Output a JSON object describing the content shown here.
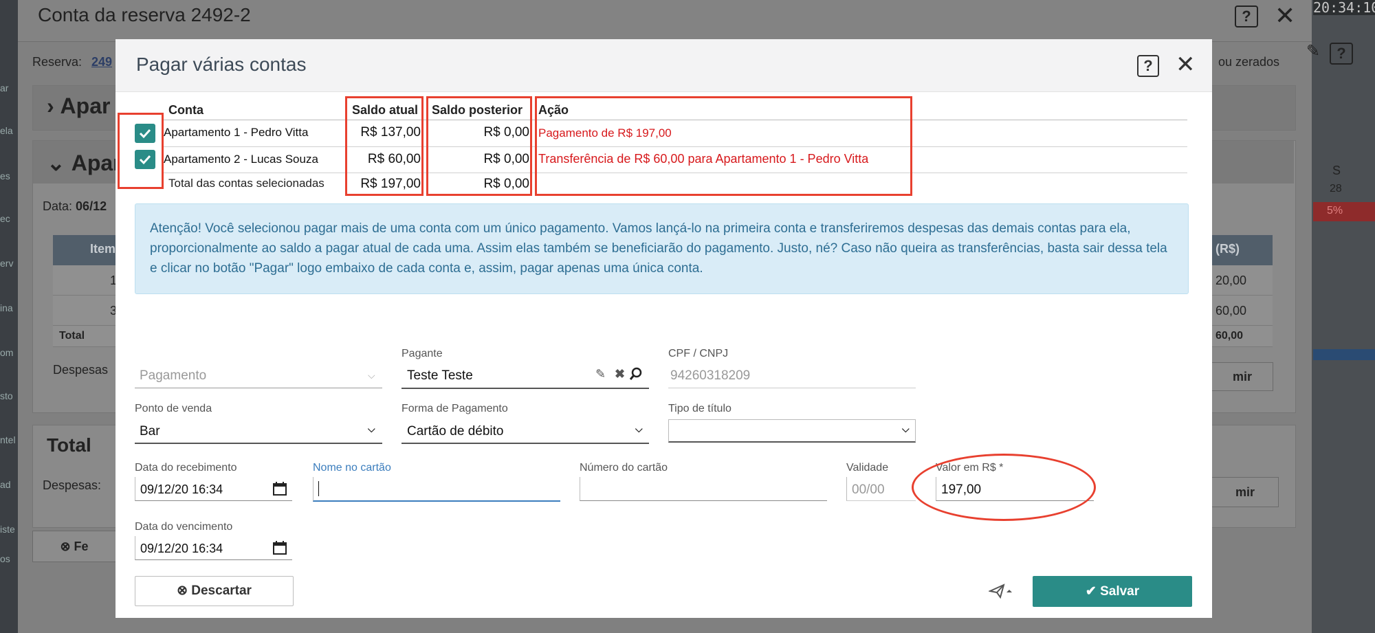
{
  "background": {
    "clock": "20:34:10",
    "outer_title": "Conta da reserva 2492-2",
    "reserva_label": "Reserva:",
    "reserva_value": "249",
    "zerados_text": "ou zerados",
    "panel1_title": "Apar",
    "panel2_title": "Apar",
    "data_label": "Data:",
    "data_value": "06/12",
    "item_header": "Item",
    "rs_header": "(R$)",
    "row1_no": "1",
    "row2_no": "3",
    "total_row": "Total",
    "row1_value": "20,00",
    "row2_value": "60,00",
    "total_value": "60,00",
    "despesas1": "Despesas",
    "imir1": "mir",
    "total_section": "Total",
    "despesas2": "Despesas:",
    "imir2": "mir",
    "fe_button": "Fe",
    "cal_day": "S",
    "cal_num": "28",
    "cal_pct": "5%",
    "left_letters": [
      "ar",
      "ela",
      "es",
      "ec",
      "erv",
      "ina",
      "om",
      "sto",
      "ntel",
      "ad",
      "iste",
      "os"
    ]
  },
  "dialog": {
    "title": "Pagar várias contas",
    "table": {
      "headers": {
        "conta": "Conta",
        "saldo_atual": "Saldo atual",
        "saldo_posterior": "Saldo posterior",
        "acao": "Ação"
      },
      "rows": [
        {
          "conta": "Apartamento 1 - Pedro Vitta",
          "saldo_atual": "R$ 137,00",
          "saldo_posterior": "R$ 0,00",
          "acao": "Pagamento de R$ 197,00"
        },
        {
          "conta": "Apartamento 2 - Lucas Souza",
          "saldo_atual": "R$ 60,00",
          "saldo_posterior": "R$ 0,00",
          "acao": "Transferência de R$ 60,00 para Apartamento 1 - Pedro Vitta"
        }
      ],
      "total": {
        "label": "Total das contas selecionadas",
        "saldo_atual": "R$ 197,00",
        "saldo_posterior": "R$ 0,00"
      }
    },
    "alert": "Atenção! Você selecionou pagar mais de uma conta com um único pagamento. Vamos lançá-lo na primeira conta e transferiremos despesas das demais contas para ela, proporcionalmente ao saldo a pagar atual de cada uma. Assim elas também se beneficiarão do pagamento. Justo, né? Caso não queira as transferências, basta sair dessa tela e clicar no botão \"Pagar\" logo embaixo de cada conta e, assim, pagar apenas uma única conta.",
    "form": {
      "pagamento_placeholder": "Pagamento",
      "pagante_label": "Pagante",
      "pagante_value": "Teste Teste",
      "cpf_label": "CPF / CNPJ",
      "cpf_value": "94260318209",
      "ponto_label": "Ponto de venda",
      "ponto_value": "Bar",
      "forma_label": "Forma de Pagamento",
      "forma_value": "Cartão de débito",
      "tipo_label": "Tipo de título",
      "tipo_value": "",
      "data_receb_label": "Data do recebimento",
      "data_receb_value": "09/12/20 16:34",
      "nome_label": "Nome no cartão",
      "nome_value": "",
      "numero_label": "Número do cartão",
      "numero_value": "",
      "validade_label": "Validade",
      "validade_placeholder": "00/00",
      "valor_label": "Valor em R$ *",
      "valor_value": "197,00",
      "data_venc_label": "Data do vencimento",
      "data_venc_value": "09/12/20 16:34"
    },
    "buttons": {
      "discard": "Descartar",
      "save": "Salvar"
    }
  },
  "colors": {
    "accent": "#2a8c87",
    "annotation": "#e8402f",
    "action_text": "#d7191c",
    "alert_bg": "#d9ecf7"
  }
}
